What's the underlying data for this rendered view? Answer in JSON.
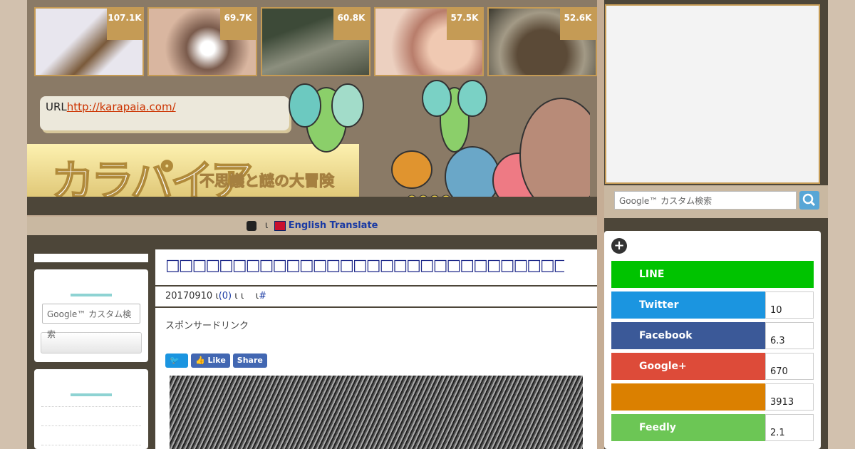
{
  "thumbnails": [
    {
      "count": "107.1K",
      "colors": [
        "#e8e6ee",
        "#7a5a3a"
      ]
    },
    {
      "count": "69.7K",
      "colors": [
        "#d9b6a0",
        "#7a5b4c"
      ]
    },
    {
      "count": "60.8K",
      "colors": [
        "#3d4a38",
        "#8c8f7e"
      ]
    },
    {
      "count": "57.5K",
      "colors": [
        "#f0c9b2",
        "#b87d6b"
      ]
    },
    {
      "count": "52.6K",
      "colors": [
        "#5b4a37",
        "#a39a86"
      ]
    }
  ],
  "header": {
    "url_prefix": "URL",
    "url": "http://karapaia.com/",
    "logo": "カラパイア",
    "tagline": "不思議と謎の大冒険"
  },
  "translate": {
    "separator": "ι",
    "label": "English Translate"
  },
  "left_sidebar": {
    "search_placeholder": "Google™ カスタム検索"
  },
  "article": {
    "title": "□□□□□□□□□□□□□□□□□□□□□□□□□□□□□□□□□□□□□□",
    "date": "20170910",
    "comments": "(0)",
    "sep1": "ι",
    "sep2": "ι ι",
    "sep3": "ι",
    "hash": "#",
    "sponsor": "スポンサードリンク",
    "share": {
      "tweet": "🐦",
      "like": "👍 Like",
      "share": "Share"
    }
  },
  "right_sidebar": {
    "search_placeholder": "Google™ カスタム検索",
    "plus": "+",
    "share_services": [
      {
        "name": "LINE",
        "count": "",
        "color": "#00c300"
      },
      {
        "name": "Twitter",
        "count": "10",
        "color": "#1b95e0"
      },
      {
        "name": "Facebook",
        "count": "6.3",
        "color": "#3b5998"
      },
      {
        "name": "Google+",
        "count": "670",
        "color": "#dd4b39"
      },
      {
        "name": "",
        "count": "3913",
        "color": "#db8000"
      },
      {
        "name": "Feedly",
        "count": "2.1",
        "color": "#6cc655"
      }
    ]
  }
}
